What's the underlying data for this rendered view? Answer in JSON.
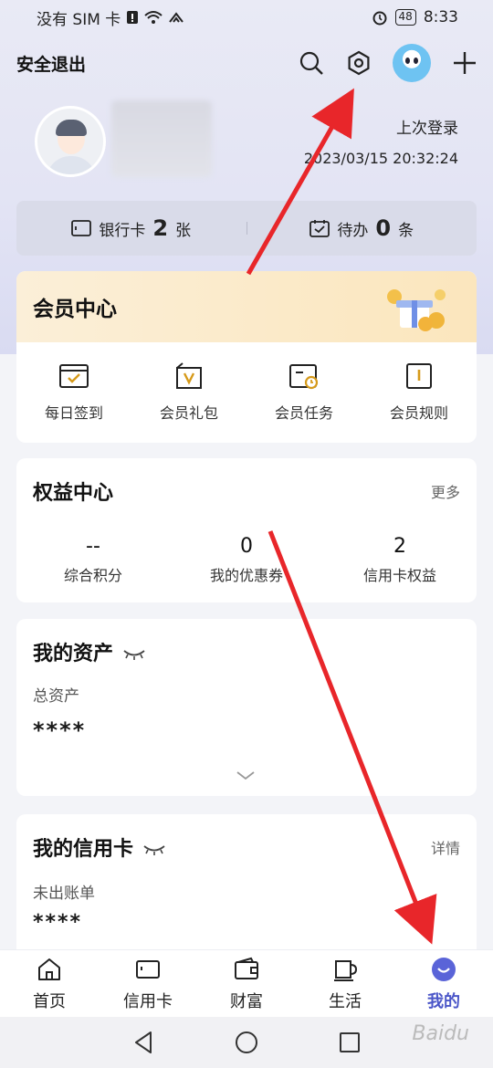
{
  "status_bar": {
    "carrier": "没有 SIM 卡",
    "battery": "48",
    "time": "8:33"
  },
  "header": {
    "logout_label": "安全退出",
    "icons": [
      "search-icon",
      "settings-gear-icon",
      "mascot-avatar",
      "add-icon"
    ]
  },
  "profile": {
    "last_login_label": "上次登录",
    "last_login_time": "2023/03/15 20:32:24"
  },
  "stats": [
    {
      "label": "银行卡",
      "value": "2",
      "unit": "张"
    },
    {
      "label": "待办",
      "value": "0",
      "unit": "条"
    }
  ],
  "member_center": {
    "title": "会员中心",
    "items": [
      {
        "label": "每日签到",
        "icon": "checkin-icon"
      },
      {
        "label": "会员礼包",
        "icon": "gift-bag-icon"
      },
      {
        "label": "会员任务",
        "icon": "task-icon"
      },
      {
        "label": "会员规则",
        "icon": "rules-book-icon"
      }
    ]
  },
  "rights_center": {
    "title": "权益中心",
    "more": "更多",
    "items": [
      {
        "value": "--",
        "label": "综合积分"
      },
      {
        "value": "0",
        "label": "我的优惠券"
      },
      {
        "value": "2",
        "label": "信用卡权益"
      }
    ]
  },
  "assets": {
    "title": "我的资产",
    "subtitle": "总资产",
    "masked_value": "****"
  },
  "credit_card": {
    "title": "我的信用卡",
    "more": "详情",
    "subtitle": "未出账单",
    "masked_value": "****"
  },
  "tabbar": {
    "items": [
      {
        "label": "首页",
        "icon": "home-icon"
      },
      {
        "label": "信用卡",
        "icon": "card-icon"
      },
      {
        "label": "财富",
        "icon": "wallet-icon"
      },
      {
        "label": "生活",
        "icon": "cup-icon"
      },
      {
        "label": "我的",
        "icon": "me-icon",
        "active": true
      }
    ]
  },
  "colors": {
    "accent": "#4b56c8",
    "arrow": "#e8262a",
    "member_gold": "#fbe6bd"
  }
}
